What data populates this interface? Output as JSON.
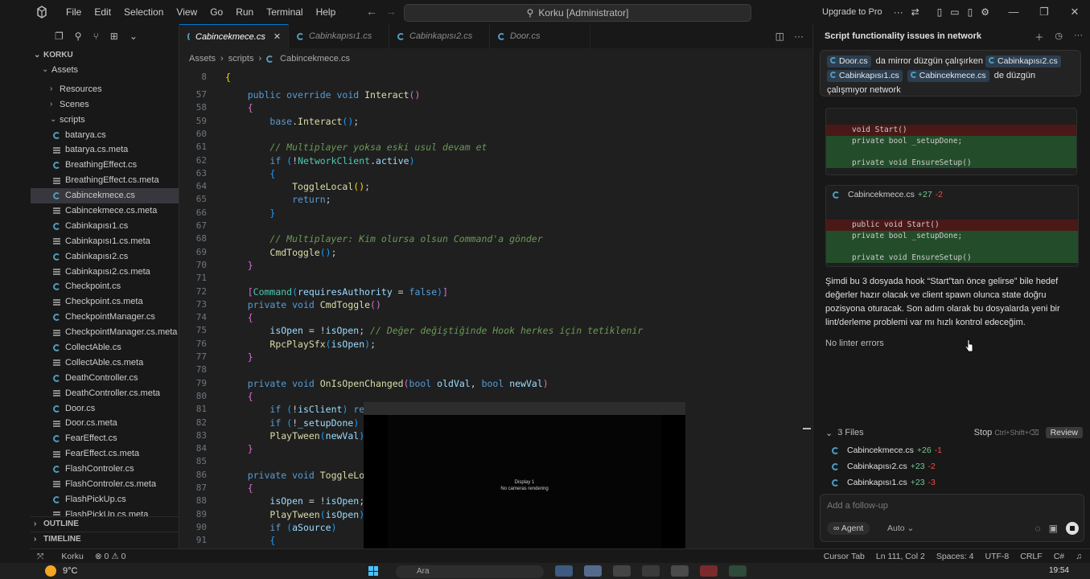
{
  "titlebar": {
    "menu": [
      "File",
      "Edit",
      "Selection",
      "View",
      "Go",
      "Run",
      "Terminal",
      "Help"
    ],
    "search": "Korku [Administrator]",
    "upgrade": "Upgrade to Pro"
  },
  "explorer": {
    "root": "KORKU",
    "assets": "Assets",
    "folders": [
      "Resources",
      "Scenes"
    ],
    "scripts_folder": "scripts",
    "files": [
      {
        "name": "batarya.cs",
        "kind": "cs"
      },
      {
        "name": "batarya.cs.meta",
        "kind": "meta"
      },
      {
        "name": "BreathingEffect.cs",
        "kind": "cs"
      },
      {
        "name": "BreathingEffect.cs.meta",
        "kind": "meta"
      },
      {
        "name": "Cabincekmece.cs",
        "kind": "cs",
        "selected": true
      },
      {
        "name": "Cabincekmece.cs.meta",
        "kind": "meta"
      },
      {
        "name": "Cabinkapısı1.cs",
        "kind": "cs"
      },
      {
        "name": "Cabinkapısı1.cs.meta",
        "kind": "meta"
      },
      {
        "name": "Cabinkapısı2.cs",
        "kind": "cs"
      },
      {
        "name": "Cabinkapısı2.cs.meta",
        "kind": "meta"
      },
      {
        "name": "Checkpoint.cs",
        "kind": "cs"
      },
      {
        "name": "Checkpoint.cs.meta",
        "kind": "meta"
      },
      {
        "name": "CheckpointManager.cs",
        "kind": "cs"
      },
      {
        "name": "CheckpointManager.cs.meta",
        "kind": "meta"
      },
      {
        "name": "CollectAble.cs",
        "kind": "cs"
      },
      {
        "name": "CollectAble.cs.meta",
        "kind": "meta"
      },
      {
        "name": "DeathController.cs",
        "kind": "cs"
      },
      {
        "name": "DeathController.cs.meta",
        "kind": "meta"
      },
      {
        "name": "Door.cs",
        "kind": "cs"
      },
      {
        "name": "Door.cs.meta",
        "kind": "meta"
      },
      {
        "name": "FearEffect.cs",
        "kind": "cs"
      },
      {
        "name": "FearEffect.cs.meta",
        "kind": "meta"
      },
      {
        "name": "FlashControler.cs",
        "kind": "cs"
      },
      {
        "name": "FlashControler.cs.meta",
        "kind": "meta"
      },
      {
        "name": "FlashPickUp.cs",
        "kind": "cs"
      },
      {
        "name": "FlashPickUp.cs.meta",
        "kind": "meta"
      }
    ],
    "outline": "OUTLINE",
    "timeline": "TIMELINE"
  },
  "tabs": [
    {
      "label": "Cabincekmece.cs",
      "active": true
    },
    {
      "label": "Cabinkapısı1.cs"
    },
    {
      "label": "Cabinkapısı2.cs"
    },
    {
      "label": "Door.cs"
    }
  ],
  "breadcrumb": [
    "Assets",
    "scripts",
    "Cabincekmece.cs"
  ],
  "code": {
    "sticky": {
      "n": "8",
      "text": "{"
    },
    "lines": [
      {
        "n": "57",
        "html": "    <span class='kw'>public override void</span> <span class='fn'>Interact</span><span class='br2'>()</span>"
      },
      {
        "n": "58",
        "html": "    <span class='br2'>{</span>"
      },
      {
        "n": "59",
        "html": "        <span class='kw'>base</span>.<span class='fn'>Interact</span><span class='br3'>()</span>;"
      },
      {
        "n": "60",
        "html": ""
      },
      {
        "n": "61",
        "html": "        <span class='cm'>// Multiplayer yoksa eski usul devam et</span>"
      },
      {
        "n": "62",
        "html": "        <span class='kw'>if</span> <span class='br3'>(</span>!<span class='ty'>NetworkClient</span>.<span class='vr'>active</span><span class='br3'>)</span>"
      },
      {
        "n": "63",
        "html": "        <span class='br3'>{</span>"
      },
      {
        "n": "64",
        "html": "            <span class='fn'>ToggleLocal</span><span class='br1'>()</span>;"
      },
      {
        "n": "65",
        "html": "            <span class='kw'>return</span>;"
      },
      {
        "n": "66",
        "html": "        <span class='br3'>}</span>"
      },
      {
        "n": "67",
        "html": ""
      },
      {
        "n": "68",
        "html": "        <span class='cm'>// Multiplayer: Kim olursa olsun Command'a gönder</span>"
      },
      {
        "n": "69",
        "html": "        <span class='fn'>CmdToggle</span><span class='br3'>()</span>;"
      },
      {
        "n": "70",
        "html": "    <span class='br2'>}</span>"
      },
      {
        "n": "71",
        "html": ""
      },
      {
        "n": "72",
        "html": "    <span class='br2'>[</span><span class='ty'>Command</span><span class='br3'>(</span><span class='vr'>requiresAuthority</span> = <span class='kw'>false</span><span class='br3'>)</span><span class='br2'>]</span>"
      },
      {
        "n": "73",
        "html": "    <span class='kw'>private void</span> <span class='fn'>CmdToggle</span><span class='br2'>()</span>"
      },
      {
        "n": "74",
        "html": "    <span class='br2'>{</span>"
      },
      {
        "n": "75",
        "html": "        <span class='vr'>isOpen</span> = !<span class='vr'>isOpen</span>; <span class='cm'>// Değer değiştiğinde Hook herkes için tetiklenir</span>"
      },
      {
        "n": "76",
        "html": "        <span class='fn'>RpcPlaySfx</span><span class='br3'>(</span><span class='vr'>isOpen</span><span class='br3'>)</span>;"
      },
      {
        "n": "77",
        "html": "    <span class='br2'>}</span>"
      },
      {
        "n": "78",
        "html": ""
      },
      {
        "n": "79",
        "html": "    <span class='kw'>private void</span> <span class='fn'>OnIsOpenChanged</span><span class='br2'>(</span><span class='kw'>bool</span> <span class='vr'>oldVal</span>, <span class='kw'>bool</span> <span class='vr'>newVal</span><span class='br2'>)</span>"
      },
      {
        "n": "80",
        "html": "    <span class='br2'>{</span>"
      },
      {
        "n": "81",
        "html": "        <span class='kw'>if</span> <span class='br3'>(</span>!<span class='vr'>isClient</span><span class='br3'>)</span> <span class='kw'>ret</span>"
      },
      {
        "n": "82",
        "html": "        <span class='kw'>if</span> <span class='br3'>(</span>!<span class='vr'>_setupDone</span><span class='br3'>)</span> E"
      },
      {
        "n": "83",
        "html": "        <span class='fn'>PlayTween</span><span class='br3'>(</span><span class='vr'>newVal</span><span class='br3'>)</span>;"
      },
      {
        "n": "84",
        "html": "    <span class='br2'>}</span>"
      },
      {
        "n": "85",
        "html": ""
      },
      {
        "n": "86",
        "html": "    <span class='kw'>private void</span> <span class='fn'>ToggleLoc</span>"
      },
      {
        "n": "87",
        "html": "    <span class='br2'>{</span>"
      },
      {
        "n": "88",
        "html": "        <span class='vr'>isOpen</span> = !<span class='vr'>isOpen</span>;"
      },
      {
        "n": "89",
        "html": "        <span class='fn'>PlayTween</span><span class='br3'>(</span><span class='vr'>isOpen</span><span class='br3'>)</span>;"
      },
      {
        "n": "90",
        "html": "        <span class='kw'>if</span> <span class='br3'>(</span><span class='vr'>aSource</span><span class='br3'>)</span>"
      },
      {
        "n": "91",
        "html": "        <span class='br3'>{</span>"
      }
    ]
  },
  "overlay": {
    "line1": "Display 1",
    "line2": "No cameras rendering"
  },
  "chat": {
    "title": "Script functionality issues in network",
    "user": {
      "chip1": "Door.cs",
      "text1": "da mirror düzgün çalışırken",
      "chip2": "Cabinkapısı2.cs",
      "chip3": "Cabinkapısı1.cs",
      "chip4": "Cabincekmece.cs",
      "text2": "de düzgün",
      "text3": "çalışmıyor network"
    },
    "diff1": {
      "lines": [
        {
          "t": "void Start()",
          "k": "del"
        },
        {
          "t": "private bool _setupDone;",
          "k": "add"
        },
        {
          "t": "",
          "k": "add"
        },
        {
          "t": "private void EnsureSetup()",
          "k": "add"
        }
      ]
    },
    "diff2": {
      "file": "Cabincekmece.cs",
      "plus": "+27",
      "minus": "-2",
      "lines": [
        {
          "t": "public void Start()",
          "k": "del"
        },
        {
          "t": "private bool _setupDone;",
          "k": "add"
        },
        {
          "t": "",
          "k": "add"
        },
        {
          "t": "private void EnsureSetup()",
          "k": "add"
        }
      ]
    },
    "paragraph": "Şimdi bu 3 dosyada hook “Start”tan önce gelirse” bile hedef değerler hazır olacak ve client spawn olunca state doğru pozisyona oturacak. Son adım olarak bu dosyalarda yeni bir lint/derleme problemi var mı hızlı kontrol edeceğim.",
    "nolint": "No linter errors",
    "files_header": "3 Files",
    "stop": "Stop",
    "stop_shortcut": "Ctrl+Shift+⌫",
    "review": "Review",
    "files": [
      {
        "name": "Cabincekmece.cs",
        "plus": "+26",
        "minus": "-1"
      },
      {
        "name": "Cabinkapısı2.cs",
        "plus": "+23",
        "minus": "-2"
      },
      {
        "name": "Cabinkapısı1.cs",
        "plus": "+23",
        "minus": "-3"
      }
    ],
    "placeholder": "Add a follow-up",
    "agent": "Agent",
    "auto": "Auto"
  },
  "status": {
    "branch": "Korku",
    "problems": "⊗ 0 ⚠ 0",
    "right": [
      "Cursor Tab",
      "Ln 111, Col 2",
      "Spaces: 4",
      "UTF-8",
      "CRLF",
      "C#"
    ]
  },
  "taskbar": {
    "temp": "9°C",
    "search": "Ara",
    "time": "19:54"
  }
}
